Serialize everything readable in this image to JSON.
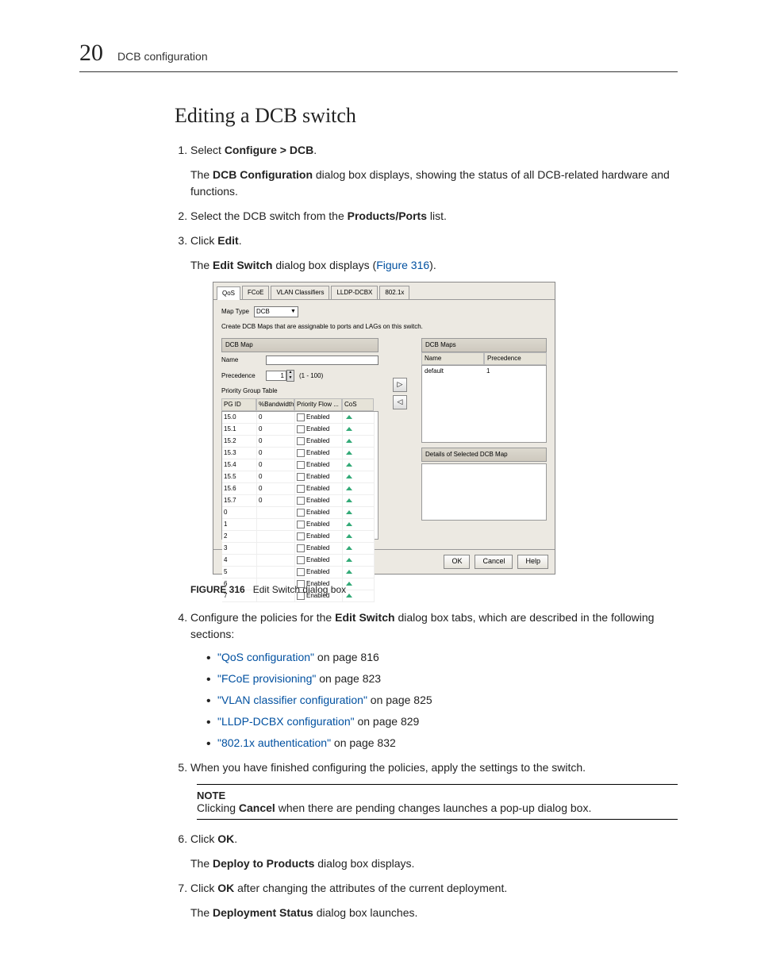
{
  "header": {
    "page_number": "20",
    "crumb": "DCB configuration"
  },
  "title": "Editing a DCB switch",
  "step1": {
    "prefix": "Select ",
    "bold": "Configure > DCB",
    "suffix": ".",
    "sub_pre": "The ",
    "sub_bold": "DCB Configuration",
    "sub_post": " dialog box displays, showing the status of all DCB-related hardware and functions."
  },
  "step2": {
    "prefix": "Select the DCB switch from the ",
    "bold": "Products/Ports",
    "suffix": " list."
  },
  "step3": {
    "prefix": "Click ",
    "bold": "Edit",
    "suffix": ".",
    "sub_pre": "The ",
    "sub_bold": "Edit Switch",
    "sub_mid": " dialog box displays (",
    "link": "Figure 316",
    "sub_end": ")."
  },
  "figure": {
    "label": "FIGURE 316",
    "caption": "Edit Switch dialog box"
  },
  "shot": {
    "tabs": [
      "QoS",
      "FCoE",
      "VLAN Classifiers",
      "LLDP-DCBX",
      "802.1x"
    ],
    "map_type_lbl": "Map Type",
    "map_type_val": "DCB",
    "instruction": "Create DCB Maps that are assignable to ports and LAGs on this switch.",
    "dcb_map_title": "DCB Map",
    "name_lbl": "Name",
    "prec_lbl": "Precedence",
    "prec_val": "1",
    "prec_range": "(1 - 100)",
    "pgt_lbl": "Priority Group Table",
    "cols": [
      "PG ID",
      "%Bandwidth",
      "Priority Flow ...",
      "CoS"
    ],
    "rows": [
      {
        "id": "15.0",
        "bw": "0",
        "pf": "Enabled"
      },
      {
        "id": "15.1",
        "bw": "0",
        "pf": "Enabled"
      },
      {
        "id": "15.2",
        "bw": "0",
        "pf": "Enabled"
      },
      {
        "id": "15.3",
        "bw": "0",
        "pf": "Enabled"
      },
      {
        "id": "15.4",
        "bw": "0",
        "pf": "Enabled"
      },
      {
        "id": "15.5",
        "bw": "0",
        "pf": "Enabled"
      },
      {
        "id": "15.6",
        "bw": "0",
        "pf": "Enabled"
      },
      {
        "id": "15.7",
        "bw": "0",
        "pf": "Enabled"
      },
      {
        "id": "0",
        "bw": "",
        "pf": "Enabled"
      },
      {
        "id": "1",
        "bw": "",
        "pf": "Enabled"
      },
      {
        "id": "2",
        "bw": "",
        "pf": "Enabled"
      },
      {
        "id": "3",
        "bw": "",
        "pf": "Enabled"
      },
      {
        "id": "4",
        "bw": "",
        "pf": "Enabled"
      },
      {
        "id": "5",
        "bw": "",
        "pf": "Enabled"
      },
      {
        "id": "6",
        "bw": "",
        "pf": "Enabled"
      },
      {
        "id": "7",
        "bw": "",
        "pf": "Enabled"
      }
    ],
    "maps_title": "DCB Maps",
    "maps_cols": [
      "Name",
      "Precedence"
    ],
    "maps_row": {
      "n": "default",
      "p": "1"
    },
    "details_title": "Details of Selected DCB Map",
    "ok": "OK",
    "cancel": "Cancel",
    "help": "Help"
  },
  "step4": {
    "pre": "Configure the policies for the ",
    "bold": "Edit Switch",
    "post": " dialog box tabs, which are described in the following sections:",
    "links": [
      {
        "t": "\"QoS configuration\"",
        "p": " on page 816"
      },
      {
        "t": "\"FCoE provisioning\"",
        "p": " on page 823"
      },
      {
        "t": "\"VLAN classifier configuration\"",
        "p": " on page 825"
      },
      {
        "t": "\"LLDP-DCBX configuration\"",
        "p": " on page 829"
      },
      {
        "t": "\"802.1x authentication\"",
        "p": " on page 832"
      }
    ]
  },
  "step5": "When you have finished configuring the policies, apply the settings to the switch.",
  "note": {
    "title": "NOTE",
    "pre": "Clicking ",
    "bold": "Cancel",
    "post": " when there are pending changes launches a pop-up dialog box."
  },
  "step6": {
    "pre": "Click ",
    "bold": "OK",
    "suf": ".",
    "sub_pre": "The ",
    "sub_bold": "Deploy to Products",
    "sub_post": " dialog box displays."
  },
  "step7": {
    "pre": "Click ",
    "bold": "OK",
    "suf": " after changing the attributes of the current deployment.",
    "sub_pre": "The ",
    "sub_bold": "Deployment Status",
    "sub_post": " dialog box launches."
  }
}
